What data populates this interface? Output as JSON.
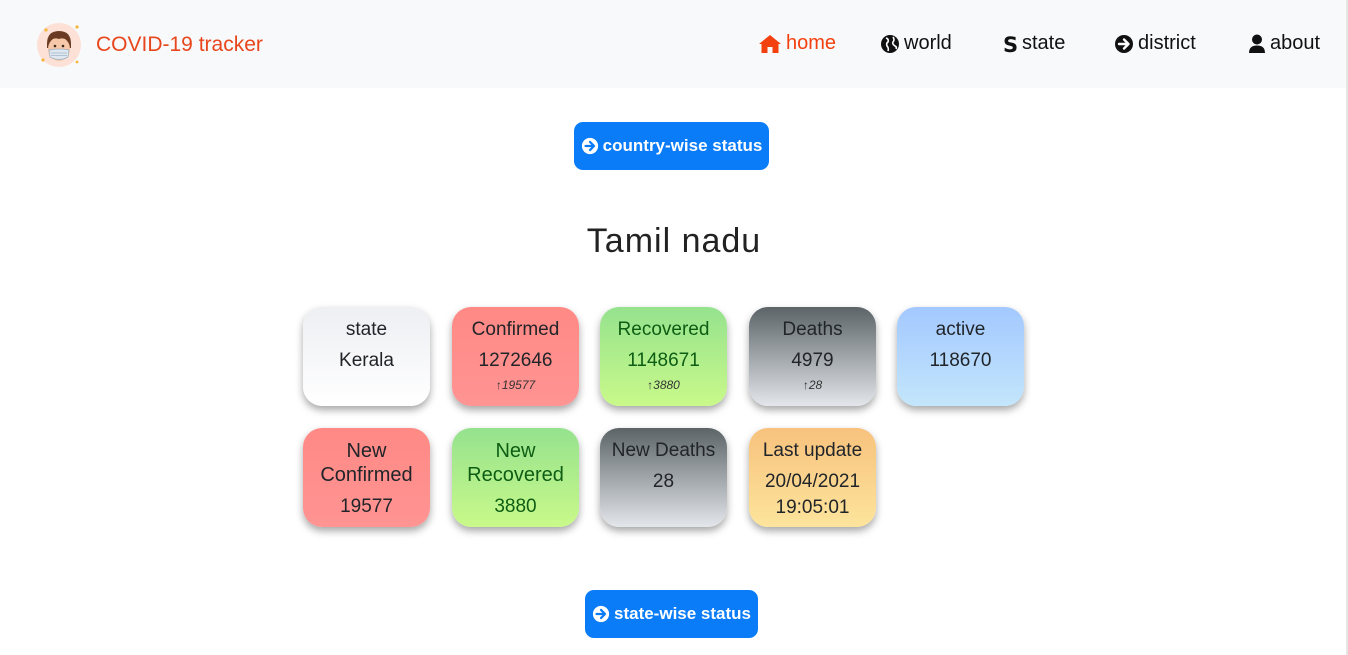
{
  "brand": {
    "name": "COVID-19 tracker"
  },
  "nav": {
    "items": [
      {
        "label": "home",
        "icon": "home-icon",
        "active": true
      },
      {
        "label": "world",
        "icon": "globe-icon",
        "active": false
      },
      {
        "label": "state",
        "icon": "s-letter-icon",
        "active": false
      },
      {
        "label": "district",
        "icon": "arrow-circle-right-icon",
        "active": false
      },
      {
        "label": "about",
        "icon": "user-icon",
        "active": false
      }
    ]
  },
  "buttons": {
    "country_wise": "country-wise status",
    "state_wise": "state-wise status"
  },
  "region_title": "Tamil nadu",
  "cards": {
    "state": {
      "label": "state",
      "value": "Kerala"
    },
    "confirmed": {
      "label": "Confirmed",
      "value": "1272646",
      "delta": "19577"
    },
    "recovered": {
      "label": "Recovered",
      "value": "1148671",
      "delta": "3880"
    },
    "deaths": {
      "label": "Deaths",
      "value": "4979",
      "delta": "28"
    },
    "active": {
      "label": "active",
      "value": "118670"
    },
    "new_confirmed": {
      "label_line1": "New",
      "label_line2": "Confirmed",
      "value": "19577"
    },
    "new_recovered": {
      "label_line1": "New",
      "label_line2": "Recovered",
      "value": "3880"
    },
    "new_deaths": {
      "label": "New Deaths",
      "value": "28"
    },
    "last_update": {
      "label": "Last update",
      "date": "20/04/2021",
      "time": "19:05:01"
    }
  },
  "colors": {
    "brand_accent": "#e8461c",
    "nav_active": "#f2400f",
    "button_bg": "#0a7cf8"
  }
}
